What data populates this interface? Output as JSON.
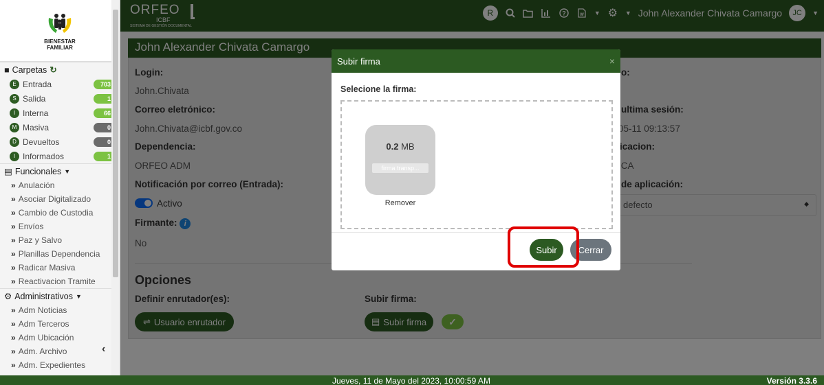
{
  "logo": {
    "line1": "BIENESTAR",
    "line2": "FAMILIAR"
  },
  "brand": {
    "name": "ORFEO",
    "sub": "ICBF",
    "tagline": "SISTEMA DE GESTIÓN DOCUMENTAL"
  },
  "nav": {
    "avatar_r": "R",
    "user_name": "John Alexander Chivata Camargo",
    "avatar_initials": "JC"
  },
  "sidebar": {
    "carpetas_label": "Carpetas",
    "folders": [
      {
        "letter": "E",
        "label": "Entrada",
        "count": "703",
        "badge_color": "green"
      },
      {
        "letter": "S",
        "label": "Salida",
        "count": "1",
        "badge_color": "green"
      },
      {
        "letter": "I",
        "label": "Interna",
        "count": "66",
        "badge_color": "green"
      },
      {
        "letter": "M",
        "label": "Masiva",
        "count": "0",
        "badge_color": "gray"
      },
      {
        "letter": "D",
        "label": "Devueltos",
        "count": "0",
        "badge_color": "gray"
      },
      {
        "letter": "I",
        "label": "Informados",
        "count": "1",
        "badge_color": "green"
      }
    ],
    "funcionales_label": "Funcionales",
    "funcionales": [
      "Anulación",
      "Asociar Digitalizado",
      "Cambio de Custodia",
      "Envíos",
      "Paz y Salvo",
      "Planillas Dependencia",
      "Radicar Masiva",
      "Reactivacion Tramite"
    ],
    "administrativos_label": "Administrativos",
    "administrativos": [
      "Adm Noticias",
      "Adm Terceros",
      "Adm Ubicación",
      "Adm. Archivo",
      "Adm. Expedientes"
    ]
  },
  "page": {
    "header": "John Alexander Chivata Camargo",
    "login_label": "Login:",
    "login_value": "John.Chivata",
    "email_label": "Correo eletrónico:",
    "email_value": "John.Chivata@icbf.gov.co",
    "dep_label": "Dependencia:",
    "dep_value": "ORFEO ADM",
    "notif_label": "Notificación por correo (Entrada):",
    "notif_value": "Activo",
    "firmante_label": "Firmante:",
    "firmante_value": "No",
    "r1_label": "o:",
    "r2_label": "ultima sesión:",
    "r2_value": "05-11 09:13:57",
    "r3_label": "icacion:",
    "r3_value": "ICA",
    "r4_label": "de aplicación:",
    "r4_select": "defecto",
    "opciones": "Opciones",
    "enrutador_label": "Definir enrutador(es):",
    "enrutador_btn": "Usuario enrutador",
    "firma_label": "Subir firma:",
    "firma_btn": "Subir firma"
  },
  "modal": {
    "title": "Subir firma",
    "close": "×",
    "select_label": "Selecione la firma:",
    "file_size_num": "0.2",
    "file_size_unit": "MB",
    "file_name": "firma transp...",
    "remove": "Remover",
    "submit": "Subir",
    "cancel": "Cerrar"
  },
  "footer": {
    "date": "Jueves, 11 de Mayo del 2023, 10:00:59 AM",
    "version": "Versión 3.3.6"
  },
  "colors": {
    "primary": "#2c5a22",
    "badge_green": "#7cc242",
    "badge_gray": "#6b6b6b",
    "highlight": "#e00000",
    "toggle": "#0d6efd"
  }
}
